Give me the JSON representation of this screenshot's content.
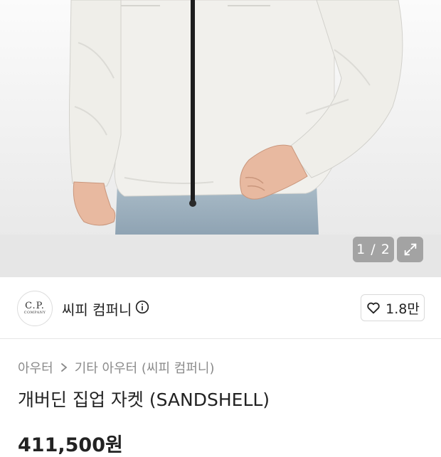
{
  "gallery": {
    "image_alt": "product-photo-jacket",
    "current_page": 1,
    "total_pages": 2,
    "counter_text": "1 / 2"
  },
  "brand": {
    "logo_line1": "C.P.",
    "logo_line2": "COMPANY",
    "name": "씨피 컴퍼니",
    "likes": "1.8만"
  },
  "breadcrumb": {
    "items": [
      "아우터",
      "기타 아우터 (씨피 컴퍼니)"
    ]
  },
  "product": {
    "title": "개버딘 집업 자켓 (SANDSHELL)",
    "price": "411,500원"
  },
  "icons": {
    "info": "info-icon",
    "heart": "heart-icon",
    "expand": "expand-icon",
    "chevron": "chevron-right-icon"
  },
  "colors": {
    "background": "#ffffff",
    "gallery_bg": "#ececec",
    "jacket": "#f1f0ec",
    "text": "#222222",
    "muted": "#8a8a8a"
  }
}
